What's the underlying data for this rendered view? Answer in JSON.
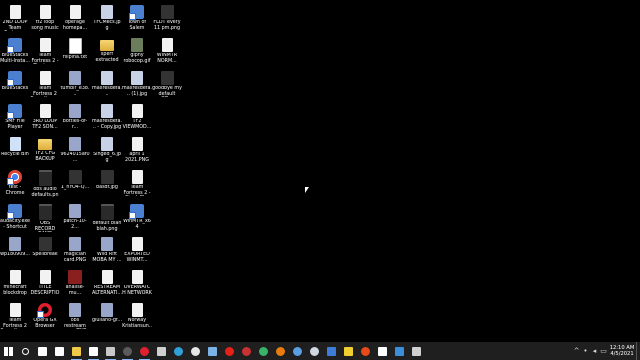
{
  "desktop": {
    "icons": [
      {
        "label": "2ND LOOP Team Fortres...",
        "kind": "doc"
      },
      {
        "label": "tf2 loop song music lmao",
        "kind": "doc"
      },
      {
        "label": "operage homepa...",
        "kind": "doc"
      },
      {
        "label": "TFCMecs.jpg",
        "kind": "jpg"
      },
      {
        "label": "Town of Salem",
        "kind": "exe"
      },
      {
        "label": "FLDT every 11 pm.png",
        "kind": "dark"
      },
      {
        "label": "BlueStacks Multi-Insta...",
        "kind": "exe"
      },
      {
        "label": "Team Fortress 2 - Playing ...",
        "kind": "doc"
      },
      {
        "label": "filipina.txt",
        "kind": "txt"
      },
      {
        "label": "sperf extracted",
        "kind": "folder"
      },
      {
        "label": "giphy robocop.gif",
        "kind": "gif"
      },
      {
        "label": "WINMTR NORM...",
        "kind": "doc"
      },
      {
        "label": "BlueStacks",
        "kind": "exe"
      },
      {
        "label": "Team Fortress 2 Soundtrac...",
        "kind": "doc"
      },
      {
        "label": "tumblr_e38...",
        "kind": "png"
      },
      {
        "label": "maxresdefa...",
        "kind": "jpg"
      },
      {
        "label": "maxresdefa... (1).jpg",
        "kind": "jpg"
      },
      {
        "label": "goodbye my default OB...",
        "kind": "dark"
      },
      {
        "label": "SMF File Player",
        "kind": "exe"
      },
      {
        "label": "3RD LOOP TF2 SON...",
        "kind": "doc"
      },
      {
        "label": "bottles-of-r...",
        "kind": "png"
      },
      {
        "label": "maxresdefa... - Copy.jpg",
        "kind": "jpg"
      },
      {
        "label": "TF2 VIEWMOD...",
        "kind": "doc"
      },
      {
        "label": "Recycle Bin",
        "kind": "bin"
      },
      {
        "label": "TF2 CFG BACKUP",
        "kind": "folder"
      },
      {
        "label": "9624015af0...",
        "kind": "png"
      },
      {
        "label": "Singed_6.jpg",
        "kind": "jpg"
      },
      {
        "label": "april 1 2021.PNG",
        "kind": "doc"
      },
      {
        "label": "test - Chrome",
        "kind": "chrome"
      },
      {
        "label": "obs audio defaults.png",
        "kind": "vid"
      },
      {
        "label": "1_nYO4-Q...",
        "kind": "dark"
      },
      {
        "label": "basdf.jpg",
        "kind": "dark"
      },
      {
        "label": "Team Fortress 2 - SinglePl...",
        "kind": "doc"
      },
      {
        "label": "audacity.exe - Shortcut",
        "kind": "exe"
      },
      {
        "label": "OBS RECORD GAME AUDI...",
        "kind": "vid"
      },
      {
        "label": "patch-10-2...",
        "kind": "png"
      },
      {
        "label": "default blah blah.png",
        "kind": "vid"
      },
      {
        "label": "WinMTR_x64",
        "kind": "exe"
      },
      {
        "label": "wp180909...",
        "kind": "png"
      },
      {
        "label": "Spellbreak",
        "kind": "dark"
      },
      {
        "label": "magician card.PNG",
        "kind": "png"
      },
      {
        "label": "Wild Rift MOBA MY ...",
        "kind": "png"
      },
      {
        "label": "EXPORTED WINMT...",
        "kind": "doc"
      },
      {
        "label": "minecraft blockdrop c...",
        "kind": "doc"
      },
      {
        "label": "TITLE DESCRIPTIO...",
        "kind": "doc"
      },
      {
        "label": "analise-mu...",
        "kind": "mus"
      },
      {
        "label": "RESTREAM ALTERNATI...",
        "kind": "doc"
      },
      {
        "label": "OVERWATCH NETWORK ...",
        "kind": "doc"
      },
      {
        "label": "Team Fortress 2 Soundtrac...",
        "kind": "doc"
      },
      {
        "label": "Opera GX Browser",
        "kind": "opera"
      },
      {
        "label": "obs restream error.PNG",
        "kind": "png"
      },
      {
        "label": "giuliano-gr...",
        "kind": "png"
      },
      {
        "label": "Norway Kristiansun...",
        "kind": "doc"
      }
    ]
  },
  "taskbar": {
    "items": [
      {
        "name": "windows-start-icon",
        "color": "#ffffff"
      },
      {
        "name": "search-icon",
        "color": "#ffffff"
      },
      {
        "name": "task-view-icon",
        "color": "#ffffff"
      },
      {
        "name": "file-icon",
        "color": "#ffffff"
      },
      {
        "name": "folder-icon",
        "color": "#f0c84a"
      },
      {
        "name": "document-icon",
        "color": "#ffffff"
      },
      {
        "name": "video-editor-icon",
        "color": "#c9c9c9"
      },
      {
        "name": "obs-icon",
        "color": "#5b5b5b"
      },
      {
        "name": "opera-icon",
        "color": "#e0202e"
      },
      {
        "name": "monitor-icon",
        "color": "#d0d0d0"
      },
      {
        "name": "edge-icon",
        "color": "#2fa0d8"
      },
      {
        "name": "cat-icon",
        "color": "#e6e6e6"
      },
      {
        "name": "game-icon",
        "color": "#7bb3e8"
      },
      {
        "name": "youtube-icon",
        "color": "#e62117"
      },
      {
        "name": "red-app-icon",
        "color": "#c83232"
      },
      {
        "name": "edge-browser-icon",
        "color": "#3ab36a"
      },
      {
        "name": "blender-icon",
        "color": "#e87d0d"
      },
      {
        "name": "network-app-icon",
        "color": "#5aa0e0"
      },
      {
        "name": "steam-icon",
        "color": "#cfd8e3"
      },
      {
        "name": "app-icon",
        "color": "#3d7dd8"
      },
      {
        "name": "lightning-icon",
        "color": "#f0d030"
      },
      {
        "name": "chrome-icon",
        "color": "#e64a19"
      },
      {
        "name": "settings-icon",
        "color": "#ffffff"
      },
      {
        "name": "folder-app-icon",
        "color": "#3b8fd9"
      },
      {
        "name": "picture-icon",
        "color": "#d0d0d0"
      }
    ],
    "tray": [
      {
        "name": "chevron-up-icon",
        "glyph": "^"
      },
      {
        "name": "microphone-icon",
        "glyph": "•"
      },
      {
        "name": "speaker-icon",
        "glyph": "◂"
      },
      {
        "name": "network-icon",
        "glyph": "▭"
      }
    ],
    "clock": {
      "time": "12:10 AM",
      "date": "4/5/2021"
    }
  },
  "colors": {
    "desktop_bg": "#000000",
    "taskbar_bg": "#1f1f1f",
    "label_text": "#ffffff"
  }
}
